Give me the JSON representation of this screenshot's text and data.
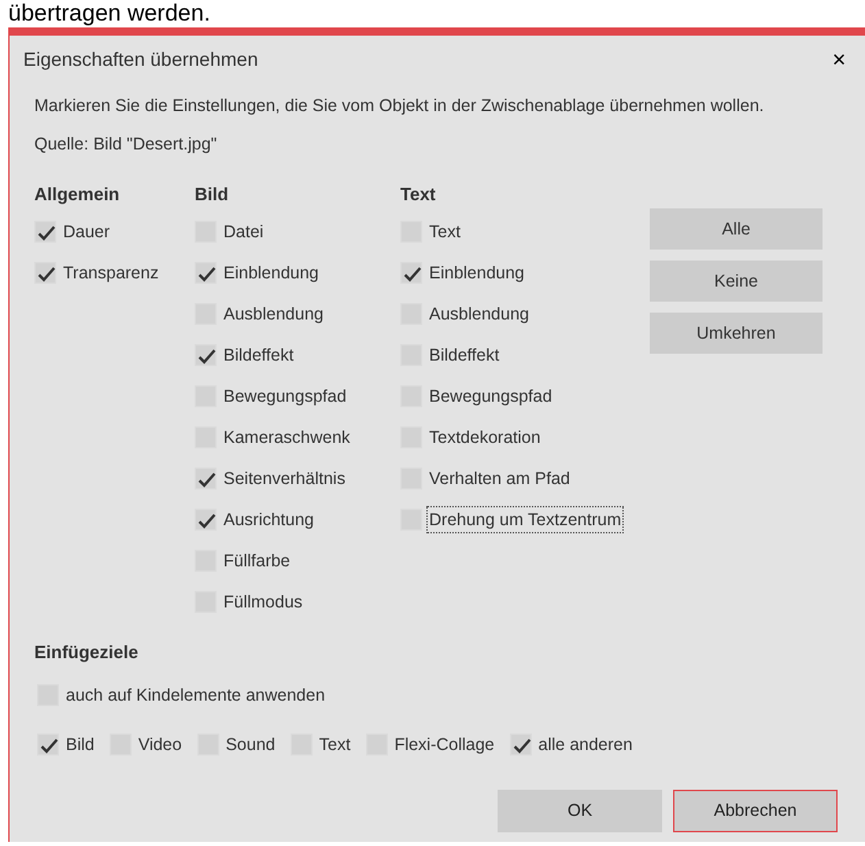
{
  "background_text": "übertragen werden.",
  "dialog": {
    "title": "Eigenschaften übernehmen",
    "close": "×",
    "instruction": "Markieren Sie die Einstellungen, die Sie vom Objekt in der Zwischenablage übernehmen wollen.",
    "source": "Quelle: Bild \"Desert.jpg\"",
    "columns": [
      {
        "heading": "Allgemein",
        "options": [
          {
            "label": "Dauer",
            "checked": true,
            "focused": false
          },
          {
            "label": "Transparenz",
            "checked": true,
            "focused": false
          }
        ]
      },
      {
        "heading": "Bild",
        "options": [
          {
            "label": "Datei",
            "checked": false,
            "focused": false
          },
          {
            "label": "Einblendung",
            "checked": true,
            "focused": false
          },
          {
            "label": "Ausblendung",
            "checked": false,
            "focused": false
          },
          {
            "label": "Bildeffekt",
            "checked": true,
            "focused": false
          },
          {
            "label": "Bewegungspfad",
            "checked": false,
            "focused": false
          },
          {
            "label": "Kameraschwenk",
            "checked": false,
            "focused": false
          },
          {
            "label": "Seitenverhältnis",
            "checked": true,
            "focused": false
          },
          {
            "label": "Ausrichtung",
            "checked": true,
            "focused": false
          },
          {
            "label": "Füllfarbe",
            "checked": false,
            "focused": false
          },
          {
            "label": "Füllmodus",
            "checked": false,
            "focused": false
          }
        ]
      },
      {
        "heading": "Text",
        "options": [
          {
            "label": "Text",
            "checked": false,
            "focused": false
          },
          {
            "label": "Einblendung",
            "checked": true,
            "focused": false
          },
          {
            "label": "Ausblendung",
            "checked": false,
            "focused": false
          },
          {
            "label": "Bildeffekt",
            "checked": false,
            "focused": false
          },
          {
            "label": "Bewegungspfad",
            "checked": false,
            "focused": false
          },
          {
            "label": "Textdekoration",
            "checked": false,
            "focused": false
          },
          {
            "label": "Verhalten am Pfad",
            "checked": false,
            "focused": false
          },
          {
            "label": "Drehung um Textzentrum",
            "checked": false,
            "focused": true
          }
        ]
      }
    ],
    "side_buttons": [
      "Alle",
      "Keine",
      "Umkehren"
    ],
    "targets": {
      "heading": "Einfügeziele",
      "apply_to_children": {
        "label": "auch auf Kindelemente anwenden",
        "checked": false
      },
      "types": [
        {
          "label": "Bild",
          "checked": true
        },
        {
          "label": "Video",
          "checked": false
        },
        {
          "label": "Sound",
          "checked": false
        },
        {
          "label": "Text",
          "checked": false
        },
        {
          "label": "Flexi-Collage",
          "checked": false
        },
        {
          "label": "alle anderen",
          "checked": true
        }
      ]
    },
    "buttons": [
      {
        "label": "OK",
        "default": false
      },
      {
        "label": "Abbrechen",
        "default": true
      }
    ]
  }
}
